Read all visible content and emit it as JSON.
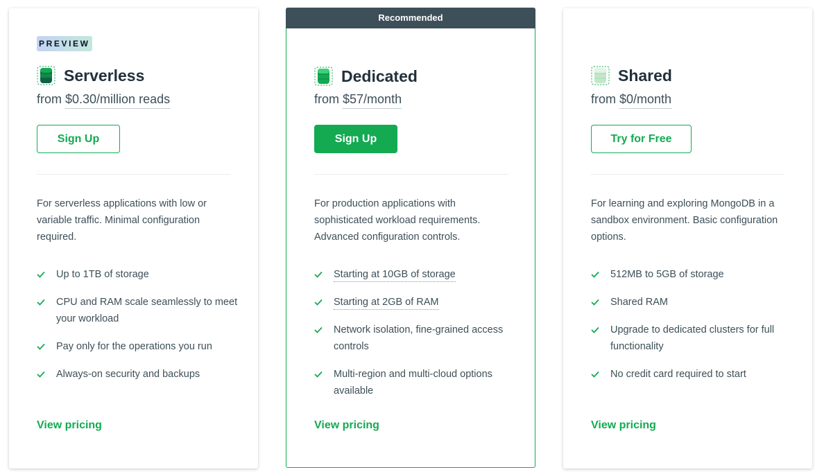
{
  "colors": {
    "accent": "#13aa52",
    "text": "#3d4f58",
    "ribbon_bg": "#3d4f58"
  },
  "serverless": {
    "badge": "PREVIEW",
    "icon": "database-icon",
    "name": "Serverless",
    "price_prefix": "from",
    "price_amount": "$0.30/million reads",
    "button": "Sign Up",
    "description": "For serverless applications with low or variable traffic. Minimal configuration required.",
    "features": [
      "Up to 1TB of storage",
      "CPU and RAM scale seamlessly to meet your workload",
      "Pay only for the operations you run",
      "Always-on security and backups"
    ],
    "link": "View pricing"
  },
  "dedicated": {
    "ribbon": "Recommended",
    "icon": "database-icon",
    "name": "Dedicated",
    "price_prefix": "from",
    "price_amount": "$57/month",
    "button": "Sign Up",
    "description": "For production applications with sophisticated workload requirements. Advanced configuration controls.",
    "features": [
      "Starting at 10GB of storage",
      "Starting at 2GB of RAM",
      "Network isolation, fine-grained access controls",
      "Multi-region and multi-cloud options available"
    ],
    "link": "View pricing"
  },
  "shared": {
    "icon": "database-icon",
    "name": "Shared",
    "price_prefix": "from",
    "price_amount": "$0/month",
    "button": "Try for Free",
    "description": "For learning and exploring MongoDB in a sandbox environment. Basic configuration options.",
    "features": [
      "512MB to 5GB of storage",
      "Shared RAM",
      "Upgrade to dedicated clusters for full functionality",
      "No credit card required to start"
    ],
    "link": "View pricing"
  }
}
